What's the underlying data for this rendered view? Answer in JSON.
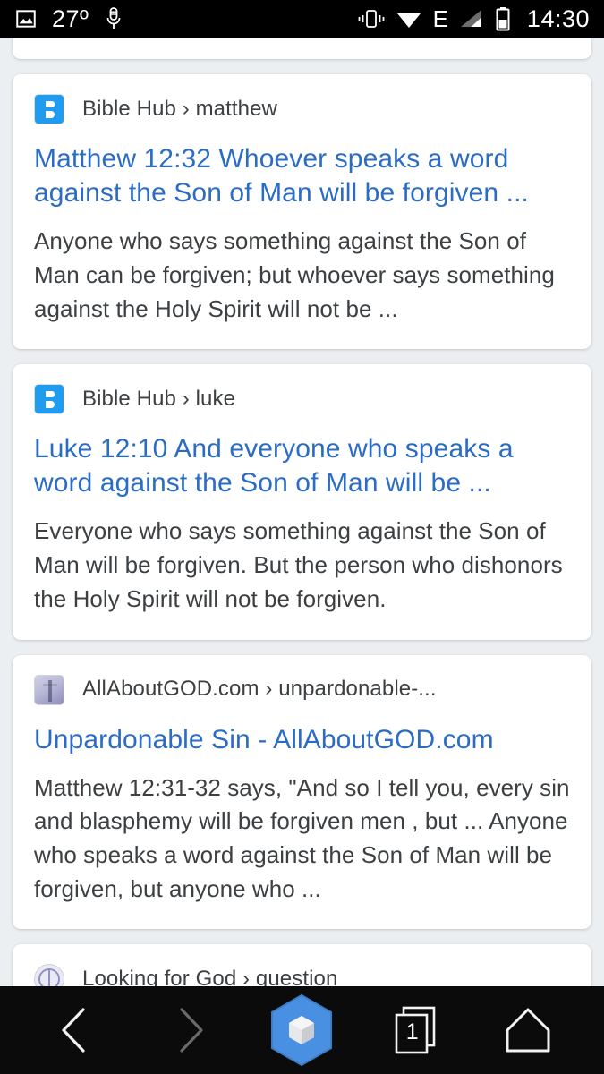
{
  "status_bar": {
    "temperature": "27º",
    "time": "14:30",
    "icons": [
      "gallery-icon",
      "microphone-icon",
      "vibrate-icon",
      "wifi-icon",
      "edge-network-icon",
      "signal-icon",
      "battery-icon"
    ],
    "network_type": "E",
    "background": "#000000"
  },
  "results": [
    {
      "favicon": "biblehub-favicon",
      "source": "Bible Hub › matthew",
      "title": "Matthew 12:32 Whoever speaks a word against the Son of Man will be forgiven ...",
      "snippet": "Anyone who says something against the Son of Man can be forgiven; but whoever says something against the Holy Spirit will not be ..."
    },
    {
      "favicon": "biblehub-favicon",
      "source": "Bible Hub › luke",
      "title": "Luke 12:10 And everyone who speaks a word against the Son of Man will be ...",
      "snippet": "Everyone who says something against the Son of Man will be forgiven. But the person who dishonors the Holy Spirit will not be forgiven."
    },
    {
      "favicon": "allaboutgod-favicon",
      "source": "AllAboutGOD.com › unpardonable-...",
      "title": "Unpardonable Sin - AllAboutGOD.com",
      "snippet": "Matthew 12:31-32 says, \"And so I tell you, every sin and blasphemy will be forgiven men , but ... Anyone who speaks a word against the Son of Man will be forgiven, but anyone who ..."
    },
    {
      "favicon": "lookingforgod-favicon",
      "source": "Looking for God › question",
      "title": "",
      "snippet": ""
    }
  ],
  "bottom_nav": {
    "back_label": "back-button",
    "forward_label": "forward-button",
    "browser_logo_label": "browser-logo",
    "tabs_count": "1",
    "home_label": "home-button",
    "accent": "#4a90e2",
    "background": "#0b0b0b"
  },
  "theme": {
    "page_background": "#eceff1",
    "card_background": "#ffffff",
    "link_color": "#2b6cc4",
    "text_color": "#3c4043",
    "favicon_blue": "#1f9cf0"
  }
}
